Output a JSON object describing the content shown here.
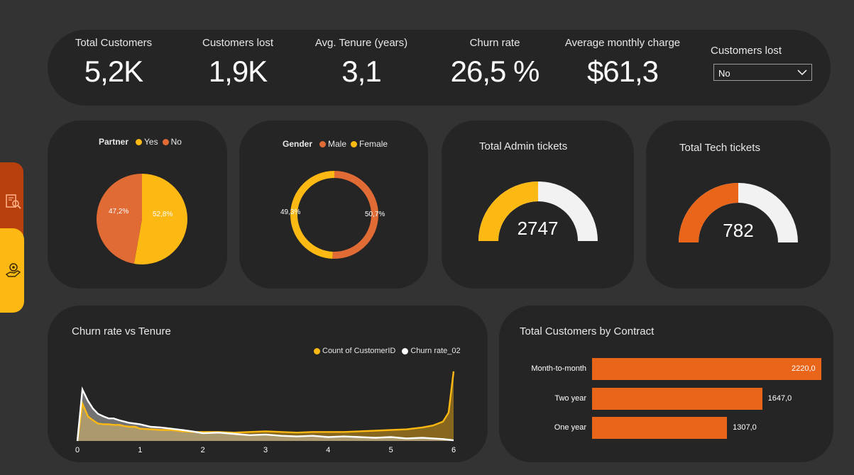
{
  "kpis": [
    {
      "label": "Total Customers",
      "value": "5,2K"
    },
    {
      "label": "Customers lost",
      "value": "1,9K"
    },
    {
      "label": "Avg. Tenure (years)",
      "value": "3,1"
    },
    {
      "label": "Churn rate",
      "value": "26,5 %"
    },
    {
      "label": "Average monthly charge",
      "value": "$61,3"
    }
  ],
  "slicer": {
    "title": "Customers lost",
    "selected": "No",
    "icon": "chevron-down-icon"
  },
  "side_nav": {
    "icons": [
      "document-search-icon",
      "hand-coin-icon"
    ],
    "colors": {
      "active": "#b8400f",
      "inactive": "#fdb913"
    }
  },
  "partner": {
    "legend_title": "Partner",
    "items": [
      {
        "label": "Yes",
        "value": 52.8,
        "value_label": "52,8%",
        "color": "#fdb913"
      },
      {
        "label": "No",
        "value": 47.2,
        "value_label": "47,2%",
        "color": "#e06b35"
      }
    ]
  },
  "gender": {
    "legend_title": "Gender",
    "items": [
      {
        "label": "Male",
        "value": 50.7,
        "value_label": "50,7%",
        "color": "#e06b35"
      },
      {
        "label": "Female",
        "value": 49.3,
        "value_label": "49,3%",
        "color": "#fdb913"
      }
    ]
  },
  "admin_tickets": {
    "title": "Total Admin tickets",
    "value": "2747",
    "fraction": 0.5,
    "color": "#fdb913",
    "track": "#f2f2f2"
  },
  "tech_tickets": {
    "title": "Total Tech tickets",
    "value": "782",
    "fraction": 0.5,
    "color": "#e8651a",
    "track": "#f2f2f2"
  },
  "churn_vs_tenure": {
    "title": "Churn rate vs Tenure",
    "legend": [
      {
        "label": "Count of CustomerID",
        "color": "#fdb913"
      },
      {
        "label": "Churn rate_02",
        "color": "#ffffff"
      }
    ],
    "x_ticks": [
      "0",
      "1",
      "2",
      "3",
      "4",
      "5",
      "6"
    ]
  },
  "contract": {
    "title": "Total Customers by Contract",
    "color": "#e8651a"
  },
  "chart_data": [
    {
      "type": "area",
      "title": "Churn rate vs Tenure",
      "xlim": [
        0,
        6
      ],
      "series": [
        {
          "name": "Count of CustomerID",
          "x": [
            0,
            0.08,
            0.17,
            0.25,
            0.33,
            0.42,
            0.5,
            0.58,
            0.67,
            0.75,
            0.83,
            0.92,
            1,
            1.17,
            1.33,
            1.5,
            1.67,
            1.83,
            2,
            2.25,
            2.5,
            2.75,
            3,
            3.25,
            3.5,
            3.75,
            4,
            4.25,
            4.5,
            4.75,
            5,
            5.25,
            5.5,
            5.67,
            5.83,
            5.92,
            6
          ],
          "values": [
            0,
            58,
            38,
            32,
            27,
            26,
            26,
            25,
            25,
            23,
            22,
            22,
            19,
            18,
            17,
            17,
            15,
            14,
            14,
            14,
            13,
            14,
            15,
            14,
            13,
            14,
            14,
            14,
            15,
            16,
            17,
            18,
            21,
            24,
            30,
            44,
            108
          ]
        },
        {
          "name": "Churn rate_02",
          "x": [
            0,
            0.08,
            0.17,
            0.25,
            0.33,
            0.42,
            0.5,
            0.58,
            0.67,
            0.75,
            0.83,
            0.92,
            1,
            1.17,
            1.33,
            1.5,
            1.67,
            1.83,
            2,
            2.25,
            2.5,
            2.75,
            3,
            3.25,
            3.5,
            3.75,
            4,
            4.25,
            4.5,
            4.75,
            5,
            5.25,
            5.5,
            5.67,
            5.83,
            5.92,
            6
          ],
          "values": [
            0,
            80,
            62,
            50,
            42,
            38,
            35,
            35,
            32,
            30,
            28,
            27,
            26,
            22,
            21,
            19,
            17,
            15,
            12,
            13,
            11,
            9,
            10,
            8,
            7,
            8,
            6,
            7,
            6,
            5,
            6,
            4,
            5,
            4,
            3,
            2,
            1
          ]
        }
      ]
    },
    {
      "type": "bar",
      "title": "Total Customers by Contract",
      "categories": [
        "Month-to-month",
        "Two year",
        "One year"
      ],
      "values": [
        2220.0,
        1647.0,
        1307.0
      ],
      "value_labels": [
        "2220,0",
        "1647,0",
        "1307,0"
      ],
      "orientation": "horizontal"
    }
  ]
}
